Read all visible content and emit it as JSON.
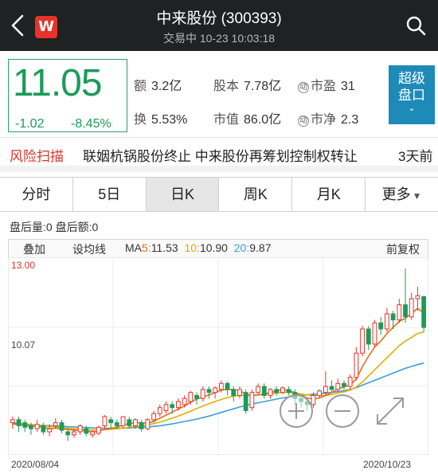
{
  "header": {
    "title": "中来股份 (300393)",
    "subtitle": "交易中 10-23 10:03:18",
    "app_logo": "W"
  },
  "quote": {
    "price": "11.05",
    "change": "-1.02",
    "change_pct": "-8.45%",
    "stats": {
      "volume_label": "额",
      "volume_value": "3.2亿",
      "capital_label": "股本",
      "capital_value": "7.78亿",
      "pe_label": "市盈",
      "pe_value": "31",
      "turnover_label": "换",
      "turnover_value": "5.53%",
      "mktcap_label": "市值",
      "mktcap_value": "86.0亿",
      "pb_label": "市净",
      "pb_value": "2.3",
      "circle_mark": "动"
    },
    "super_button": {
      "line1": "超级",
      "line2": "盘口",
      "chevron": "⌄"
    }
  },
  "ticker": {
    "tag": "风险扫描",
    "text": "联姻杭锅股份终止  中来股份再筹划控制权转让",
    "time": "3天前"
  },
  "tabs": [
    {
      "label": "分时"
    },
    {
      "label": "5日"
    },
    {
      "label": "日K"
    },
    {
      "label": "周K"
    },
    {
      "label": "月K"
    },
    {
      "label": "更多"
    }
  ],
  "after_hours": "盘后量:0  盘后额:0",
  "toolbar": {
    "overlay": "叠加",
    "set_ma": "设均线",
    "ma_prefix": "MA",
    "ma5_label": "5:",
    "ma5_value": "11.53",
    "ma10_label": "10:",
    "ma10_value": "10.90",
    "ma20_label": "20:",
    "ma20_value": "9.87",
    "adjust": "前复权"
  },
  "chart_data": {
    "type": "candlestick",
    "y_max_label": "13.00",
    "y_mid_label": "10.07",
    "x_start_label": "2020/08/04",
    "x_end_label": "2020/10/23",
    "ylim": [
      7.1,
      13.0
    ],
    "colors": {
      "up": "#e8332a",
      "down": "#1e9a5a",
      "ma5": "#e07020",
      "ma10": "#e0b000",
      "ma20": "#3aa0d8"
    },
    "candles": [
      [
        7.9,
        8.0,
        7.7,
        8.1
      ],
      [
        8.0,
        7.8,
        7.6,
        8.1
      ],
      [
        7.9,
        7.75,
        7.6,
        8.0
      ],
      [
        7.8,
        7.7,
        7.5,
        7.9
      ],
      [
        7.7,
        7.85,
        7.6,
        8.0
      ],
      [
        7.8,
        7.6,
        7.5,
        7.9
      ],
      [
        7.6,
        7.7,
        7.45,
        7.85
      ],
      [
        7.8,
        7.9,
        7.7,
        8.05
      ],
      [
        7.9,
        7.65,
        7.55,
        8.0
      ],
      [
        7.6,
        7.5,
        7.3,
        7.7
      ],
      [
        7.5,
        7.6,
        7.4,
        7.7
      ],
      [
        7.6,
        7.8,
        7.5,
        7.85
      ],
      [
        7.7,
        7.55,
        7.45,
        7.8
      ],
      [
        7.5,
        7.6,
        7.4,
        7.65
      ],
      [
        7.55,
        7.75,
        7.5,
        7.8
      ],
      [
        7.8,
        8.1,
        7.7,
        8.15
      ],
      [
        8.0,
        7.9,
        7.7,
        8.1
      ],
      [
        7.9,
        7.8,
        7.7,
        8.0
      ],
      [
        7.8,
        8.1,
        7.7,
        8.1
      ],
      [
        8.0,
        7.8,
        7.7,
        8.1
      ],
      [
        7.8,
        8.0,
        7.7,
        8.05
      ],
      [
        7.9,
        7.7,
        7.6,
        8.0
      ],
      [
        7.7,
        8.0,
        7.65,
        8.05
      ],
      [
        8.0,
        8.2,
        7.9,
        8.3
      ],
      [
        8.2,
        8.4,
        8.1,
        8.5
      ],
      [
        8.3,
        8.5,
        8.2,
        8.6
      ],
      [
        8.5,
        8.4,
        8.2,
        8.6
      ],
      [
        8.4,
        8.6,
        8.3,
        8.7
      ],
      [
        8.5,
        8.7,
        8.4,
        8.8
      ],
      [
        8.6,
        8.9,
        8.5,
        8.95
      ],
      [
        8.8,
        8.7,
        8.5,
        8.9
      ],
      [
        8.7,
        9.0,
        8.6,
        9.1
      ],
      [
        9.0,
        8.9,
        8.7,
        9.1
      ],
      [
        8.9,
        9.05,
        8.7,
        9.1
      ],
      [
        9.0,
        9.2,
        8.9,
        9.3
      ],
      [
        9.2,
        9.0,
        8.8,
        9.25
      ],
      [
        9.0,
        8.8,
        8.6,
        9.1
      ],
      [
        8.8,
        9.0,
        8.7,
        9.1
      ],
      [
        8.9,
        8.3,
        8.2,
        9.0
      ],
      [
        8.4,
        8.9,
        8.3,
        9.0
      ],
      [
        8.9,
        9.1,
        8.8,
        9.2
      ],
      [
        9.1,
        8.8,
        8.7,
        9.2
      ],
      [
        8.8,
        9.0,
        8.7,
        9.05
      ],
      [
        9.0,
        8.9,
        8.8,
        9.1
      ],
      [
        8.9,
        9.05,
        8.85,
        9.1
      ],
      [
        9.0,
        8.9,
        8.8,
        9.1
      ],
      [
        8.9,
        8.7,
        8.5,
        9.0
      ],
      [
        8.7,
        8.6,
        8.4,
        8.8
      ],
      [
        8.6,
        8.5,
        8.3,
        8.7
      ],
      [
        8.5,
        8.8,
        8.4,
        8.9
      ],
      [
        8.8,
        8.95,
        8.7,
        9.0
      ],
      [
        8.9,
        9.1,
        8.8,
        9.6
      ],
      [
        9.1,
        9.0,
        8.9,
        9.3
      ],
      [
        9.0,
        9.2,
        8.9,
        9.35
      ],
      [
        9.2,
        9.1,
        9.0,
        9.3
      ],
      [
        9.1,
        9.4,
        9.0,
        9.5
      ],
      [
        9.4,
        10.2,
        9.3,
        10.4
      ],
      [
        10.2,
        11.0,
        10.1,
        11.1
      ],
      [
        11.0,
        10.5,
        10.3,
        11.1
      ],
      [
        10.5,
        11.2,
        10.4,
        11.3
      ],
      [
        11.2,
        11.0,
        10.8,
        11.4
      ],
      [
        11.0,
        11.5,
        10.9,
        11.7
      ],
      [
        11.5,
        11.3,
        11.0,
        11.6
      ],
      [
        11.3,
        11.8,
        11.2,
        12.0
      ],
      [
        11.8,
        11.4,
        11.2,
        13.0
      ],
      [
        11.4,
        12.0,
        11.3,
        12.2
      ],
      [
        12.0,
        12.1,
        11.6,
        12.4
      ],
      [
        12.07,
        11.05,
        10.9,
        12.1
      ]
    ],
    "ma5": [
      7.9,
      7.85,
      7.8,
      7.8,
      7.78,
      7.75,
      7.7,
      7.72,
      7.7,
      7.68,
      7.65,
      7.65,
      7.62,
      7.6,
      7.62,
      7.68,
      7.72,
      7.75,
      7.82,
      7.88,
      7.9,
      7.9,
      7.88,
      7.95,
      8.05,
      8.15,
      8.25,
      8.35,
      8.45,
      8.58,
      8.68,
      8.75,
      8.82,
      8.9,
      8.98,
      9.0,
      9.0,
      8.96,
      8.85,
      8.8,
      8.82,
      8.85,
      8.9,
      8.95,
      9.0,
      8.96,
      8.9,
      8.8,
      8.72,
      8.68,
      8.72,
      8.8,
      8.9,
      9.02,
      9.08,
      9.15,
      9.35,
      9.75,
      10.1,
      10.4,
      10.6,
      10.85,
      11.05,
      11.25,
      11.35,
      11.52,
      11.68,
      11.53
    ],
    "ma10": [
      7.9,
      7.88,
      7.86,
      7.84,
      7.82,
      7.8,
      7.78,
      7.76,
      7.74,
      7.72,
      7.7,
      7.69,
      7.67,
      7.66,
      7.66,
      7.67,
      7.68,
      7.7,
      7.72,
      7.75,
      7.78,
      7.8,
      7.83,
      7.87,
      7.92,
      7.98,
      8.05,
      8.12,
      8.2,
      8.28,
      8.37,
      8.45,
      8.53,
      8.6,
      8.67,
      8.73,
      8.78,
      8.8,
      8.8,
      8.8,
      8.82,
      8.84,
      8.86,
      8.88,
      8.9,
      8.9,
      8.88,
      8.85,
      8.82,
      8.8,
      8.8,
      8.8,
      8.83,
      8.88,
      8.92,
      8.98,
      9.08,
      9.25,
      9.45,
      9.65,
      9.85,
      10.05,
      10.25,
      10.45,
      10.6,
      10.72,
      10.85,
      10.9
    ],
    "ma20": [
      7.85,
      7.85,
      7.84,
      7.83,
      7.82,
      7.81,
      7.8,
      7.79,
      7.78,
      7.77,
      7.76,
      7.75,
      7.74,
      7.73,
      7.72,
      7.72,
      7.72,
      7.72,
      7.72,
      7.73,
      7.74,
      7.75,
      7.76,
      7.78,
      7.8,
      7.83,
      7.86,
      7.9,
      7.94,
      7.98,
      8.02,
      8.07,
      8.12,
      8.18,
      8.24,
      8.3,
      8.36,
      8.42,
      8.47,
      8.52,
      8.56,
      8.6,
      8.64,
      8.68,
      8.72,
      8.75,
      8.78,
      8.8,
      8.82,
      8.84,
      8.86,
      8.88,
      8.9,
      8.93,
      8.96,
      9.0,
      9.06,
      9.14,
      9.22,
      9.3,
      9.38,
      9.46,
      9.54,
      9.62,
      9.7,
      9.76,
      9.82,
      9.87
    ]
  }
}
